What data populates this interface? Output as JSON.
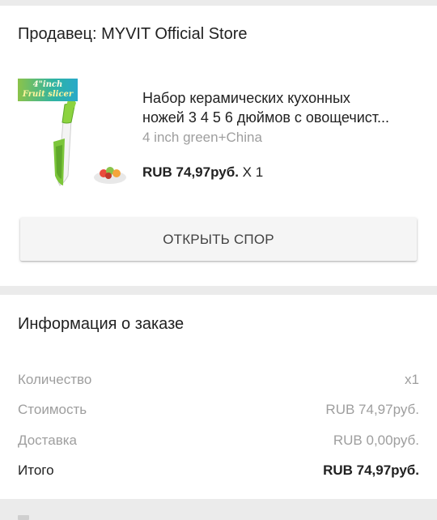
{
  "seller": {
    "title": "Продавец: MYVIT Official Store"
  },
  "product": {
    "image_tag_line1": "4\"inch",
    "image_tag_line2": "Fruit slicer",
    "name_line1": "Набор керамических кухонных",
    "name_line2": "ножей 3 4 5 6 дюймов с овощечист...",
    "variant": "4 inch green+China",
    "price": "RUB 74,97руб.",
    "quantity": "X 1"
  },
  "actions": {
    "open_dispute_label": "ОТКРЫТЬ СПОР"
  },
  "order_info": {
    "title": "Информация о заказе",
    "rows": [
      {
        "label": "Количество",
        "value": "x1"
      },
      {
        "label": "Стоимость",
        "value": "RUB 74,97руб."
      },
      {
        "label": "Доставка",
        "value": "RUB 0,00руб."
      },
      {
        "label": "Итого",
        "value": "RUB 74,97руб."
      }
    ]
  },
  "colors": {
    "background": "#ebebeb",
    "card": "#ffffff",
    "muted_text": "#9e9e9e",
    "primary_text": "#212121",
    "knife_green": "#7cc63a"
  }
}
